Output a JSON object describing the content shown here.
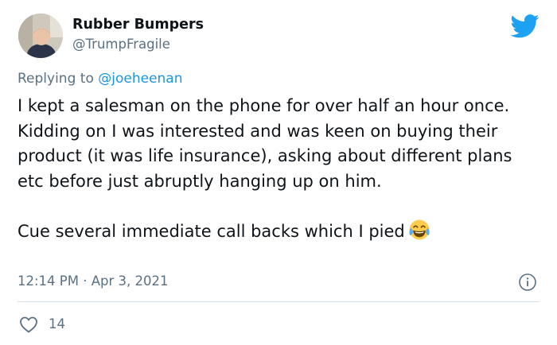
{
  "author": {
    "display_name": "Rubber Bumpers",
    "handle": "@TrumpFragile"
  },
  "reply": {
    "prefix": "Replying to ",
    "mention": "@joeheenan"
  },
  "tweet": {
    "paragraph_1": "I kept a salesman on the phone for over half an hour once. Kidding on I was interested and was keen on buying their product (it was life insurance), asking about different plans etc before just abruptly hanging up on him.",
    "paragraph_2": "Cue several immediate call backs which I pied",
    "emoji": "face-with-tears-of-joy-icon"
  },
  "meta": {
    "timestamp": "12:14 PM · Apr 3, 2021",
    "like_count": "14"
  },
  "colors": {
    "brand_blue": "#1da1f2",
    "secondary_text": "#5b7083",
    "mention_blue": "#1b95e0"
  }
}
